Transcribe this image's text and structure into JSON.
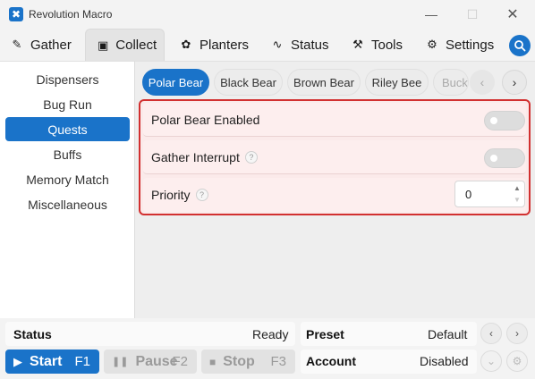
{
  "window": {
    "title": "Revolution Macro",
    "logo_glyph": "✖",
    "min_glyph": "—",
    "max_glyph": "☐",
    "close_glyph": "✕"
  },
  "tabs": [
    {
      "label": "Gather",
      "icon": "✎",
      "icon_name": "brush-icon"
    },
    {
      "label": "Collect",
      "icon": "▣",
      "icon_name": "collect-icon"
    },
    {
      "label": "Planters",
      "icon": "✿",
      "icon_name": "plant-icon"
    },
    {
      "label": "Status",
      "icon": "∿",
      "icon_name": "pulse-icon"
    },
    {
      "label": "Tools",
      "icon": "⚒",
      "icon_name": "wrench-icon"
    },
    {
      "label": "Settings",
      "icon": "⚙",
      "icon_name": "gear-icon"
    }
  ],
  "active_tab": "Collect",
  "sidebar": {
    "items": [
      "Dispensers",
      "Bug Run",
      "Quests",
      "Buffs",
      "Memory Match",
      "Miscellaneous"
    ],
    "active": "Quests"
  },
  "subtabs": {
    "items": [
      "Polar Bear",
      "Black Bear",
      "Brown Bear",
      "Riley Bee",
      "Buck"
    ],
    "active": "Polar Bear",
    "prev_glyph": "‹",
    "next_glyph": "›"
  },
  "settings": {
    "polar_enabled": {
      "label": "Polar Bear Enabled",
      "value": false
    },
    "gather_interrupt": {
      "label": "Gather Interrupt",
      "help": "?",
      "value": false
    },
    "priority": {
      "label": "Priority",
      "help": "?",
      "value": "0",
      "up_glyph": "▲",
      "down_glyph": "▼"
    }
  },
  "bottom": {
    "status_label": "Status",
    "status_value": "Ready",
    "preset_label": "Preset",
    "preset_value": "Default",
    "account_label": "Account",
    "account_value": "Disabled",
    "start": {
      "label": "Start",
      "key": "F1",
      "icon": "▶"
    },
    "pause": {
      "label": "Pause",
      "key": "F2",
      "icon": "❚❚"
    },
    "stop": {
      "label": "Stop",
      "key": "F3",
      "icon": "■"
    },
    "prev_glyph": "‹",
    "next_glyph": "›",
    "dropdown_glyph": "⌄",
    "gear_glyph": "⚙"
  },
  "colors": {
    "accent": "#1a73c9",
    "highlight_border": "#d23030",
    "highlight_bg": "#fbeaea"
  }
}
